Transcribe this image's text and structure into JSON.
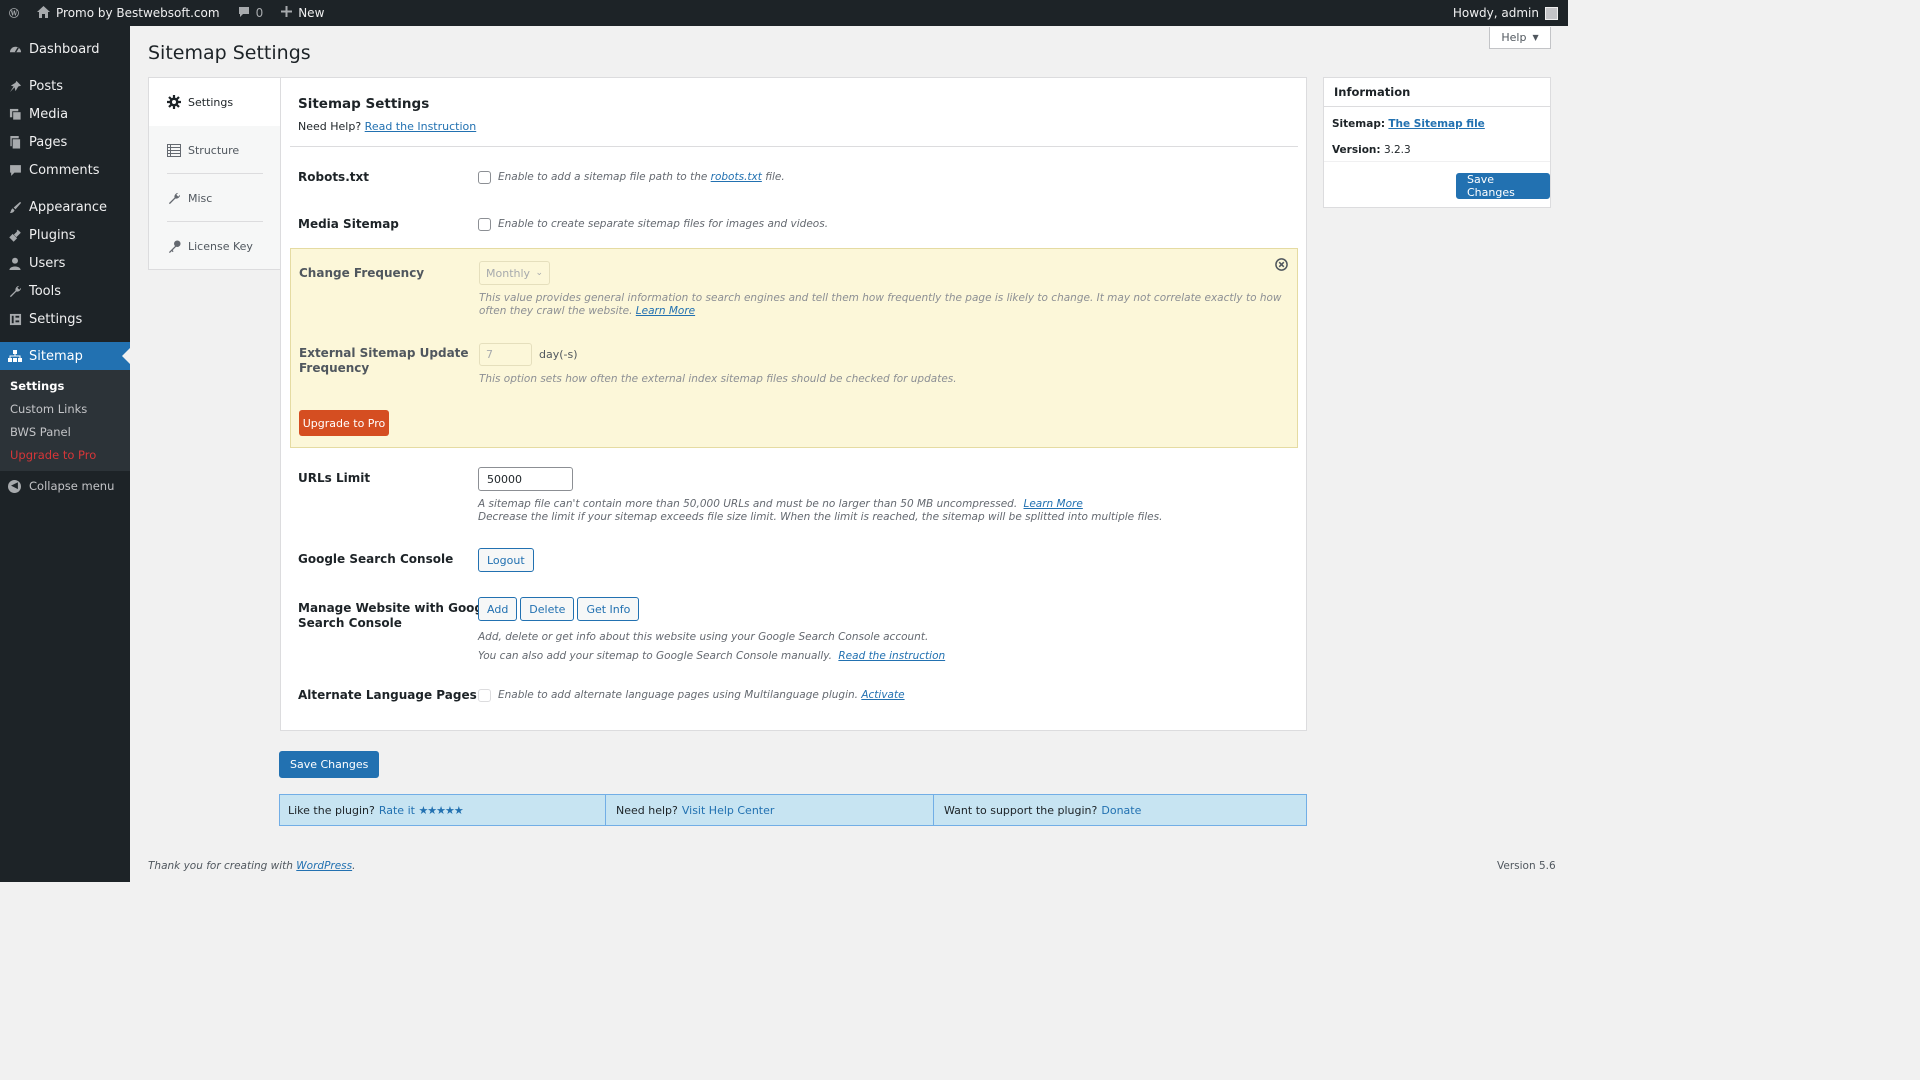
{
  "adminbar": {
    "site_name": "Promo by Bestwebsoft.com",
    "comments_count": "0",
    "new_label": "New",
    "howdy": "Howdy, admin"
  },
  "sidebar": {
    "items": [
      {
        "label": "Dashboard",
        "icon": "dashboard-icon"
      },
      {
        "label": "Posts",
        "icon": "pin-icon"
      },
      {
        "label": "Media",
        "icon": "media-icon"
      },
      {
        "label": "Pages",
        "icon": "pages-icon"
      },
      {
        "label": "Comments",
        "icon": "comment-icon"
      },
      {
        "label": "Appearance",
        "icon": "brush-icon"
      },
      {
        "label": "Plugins",
        "icon": "plugin-icon"
      },
      {
        "label": "Users",
        "icon": "user-icon"
      },
      {
        "label": "Tools",
        "icon": "wrench-icon"
      },
      {
        "label": "Settings",
        "icon": "settings-icon"
      },
      {
        "label": "Sitemap",
        "icon": "sitemap-icon"
      }
    ],
    "submenu": [
      "Settings",
      "Custom Links",
      "BWS Panel",
      "Upgrade to Pro"
    ],
    "collapse_label": "Collapse menu"
  },
  "page": {
    "title": "Sitemap Settings",
    "help_label": "Help"
  },
  "tabs": [
    "Settings",
    "Structure",
    "Misc",
    "License Key"
  ],
  "panel": {
    "heading": "Sitemap Settings",
    "need_help": "Need Help?",
    "read_instruction": "Read the Instruction",
    "robots": {
      "label": "Robots.txt",
      "desc_before": "Enable to add a sitemap file path to the",
      "link": "robots.txt",
      "desc_after": "file."
    },
    "media": {
      "label": "Media Sitemap",
      "desc": "Enable to create separate sitemap files for images and videos."
    },
    "change_freq": {
      "label": "Change Frequency",
      "value": "Monthly",
      "desc": "This value provides general information to search engines and tell them how frequently the page is likely to change. It may not correlate exactly to how often they crawl the",
      "desc2": "website.",
      "learn_more": "Learn More"
    },
    "external": {
      "label_line1": "External Sitemap Update",
      "label_line2": "Frequency",
      "value": "7",
      "unit": "day(-s)",
      "desc": "This option sets how often the external index sitemap files should be checked for updates."
    },
    "upgrade_label": "Upgrade to Pro",
    "urls": {
      "label": "URLs Limit",
      "value": "50000",
      "desc1": "A sitemap file can't contain more than 50,000 URLs and must be no larger than 50 MB uncompressed.",
      "learn_more": "Learn More",
      "desc2": "Decrease the limit if your sitemap exceeds file size limit. When the limit is reached, the sitemap will be splitted into multiple files."
    },
    "gsc": {
      "label": "Google Search Console",
      "logout": "Logout"
    },
    "manage": {
      "label_line1": "Manage Website with Google",
      "label_line2": "Search Console",
      "add": "Add",
      "delete": "Delete",
      "get_info": "Get Info",
      "desc1": "Add, delete or get info about this website using your Google Search Console account.",
      "desc2": "You can also add your sitemap to Google Search Console manually.",
      "read_instruction": "Read the instruction"
    },
    "alt_lang": {
      "label": "Alternate Language Pages",
      "desc": "Enable to add alternate language pages using Multilanguage plugin.",
      "activate": "Activate"
    }
  },
  "info": {
    "title": "Information",
    "sitemap_label": "Sitemap:",
    "sitemap_link": "The Sitemap file",
    "version_label": "Version:",
    "version_value": "3.2.3",
    "save_label": "Save Changes"
  },
  "save_label": "Save Changes",
  "support": {
    "like": "Like the plugin?",
    "rate": "Rate it",
    "stars": "★★★★★",
    "need_help": "Need help?",
    "visit": "Visit Help Center",
    "want_support": "Want to support the plugin?",
    "donate": "Donate"
  },
  "footer": {
    "thanks": "Thank you for creating with",
    "wp_link": "WordPress",
    "version": "Version 5.6"
  },
  "colors": {
    "admin_bg": "#1d2327",
    "accent": "#2271b1",
    "pro_bg": "#fcf7d9",
    "upgrade_btn": "#d54e21"
  }
}
